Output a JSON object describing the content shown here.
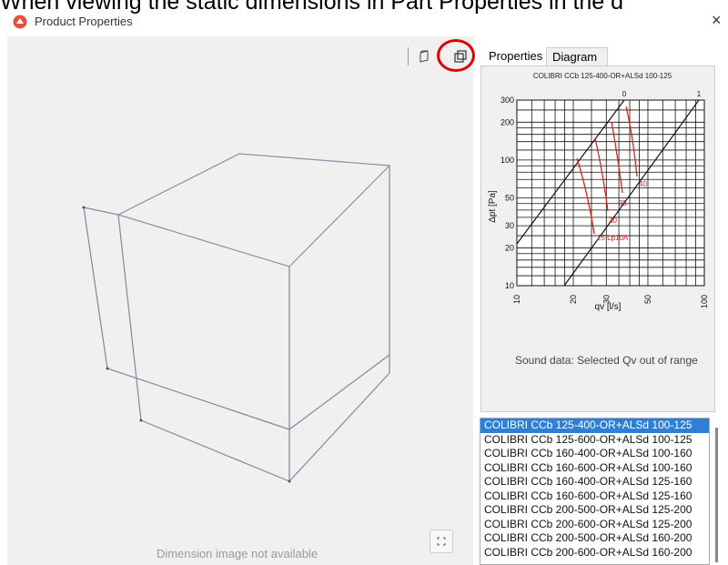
{
  "caption": "When viewing the static dimensions in Part Properties in the d",
  "window": {
    "title": "Product Properties"
  },
  "tabs": {
    "properties": "Properties",
    "diagram": "Diagram"
  },
  "viewer": {
    "dimension_text": "Dimension image not available"
  },
  "chart_data": {
    "type": "line",
    "title": "COLIBRI CCb 125-400-OR+ALSd 100-125",
    "xlabel": "qv [l/s]",
    "ylabel": "Δpt [Pa]",
    "x_ticks": [
      "10",
      "20",
      "30",
      "50",
      "100"
    ],
    "y_ticks": [
      "10",
      "20",
      "30",
      "50",
      "100",
      "200",
      "300"
    ],
    "top_ticks": [
      "0",
      "1"
    ],
    "xlim": [
      10,
      100
    ],
    "ylim": [
      10,
      300
    ],
    "x_scale": "log",
    "y_scale": "log",
    "grid": true,
    "annotations": [
      "25 Lp10A",
      "30",
      "35",
      "40"
    ],
    "sound_text": "Sound data: Selected Qv out of range"
  },
  "list": {
    "items": [
      "COLIBRI CCb 125-400-OR+ALSd 100-125",
      "COLIBRI CCb 125-600-OR+ALSd 100-125",
      "COLIBRI CCb 160-400-OR+ALSd 100-160",
      "COLIBRI CCb 160-600-OR+ALSd 100-160",
      "COLIBRI CCb 160-400-OR+ALSd 125-160",
      "COLIBRI CCb 160-600-OR+ALSd 125-160",
      "COLIBRI CCb 200-500-OR+ALSd 125-200",
      "COLIBRI CCb 200-600-OR+ALSd 125-200",
      "COLIBRI CCb 200-500-OR+ALSd 160-200",
      "COLIBRI CCb 200-600-OR+ALSd 160-200"
    ],
    "selected_index": 0
  },
  "colors": {
    "accent": "#2f7fd6",
    "highlight_circle": "#e00000",
    "curve": "#e02020"
  },
  "icons": {
    "logo": "app-logo-icon",
    "iso": "cube-iso-icon",
    "multi": "multi-view-icon",
    "expand": "expand-icon",
    "close": "close-icon"
  }
}
